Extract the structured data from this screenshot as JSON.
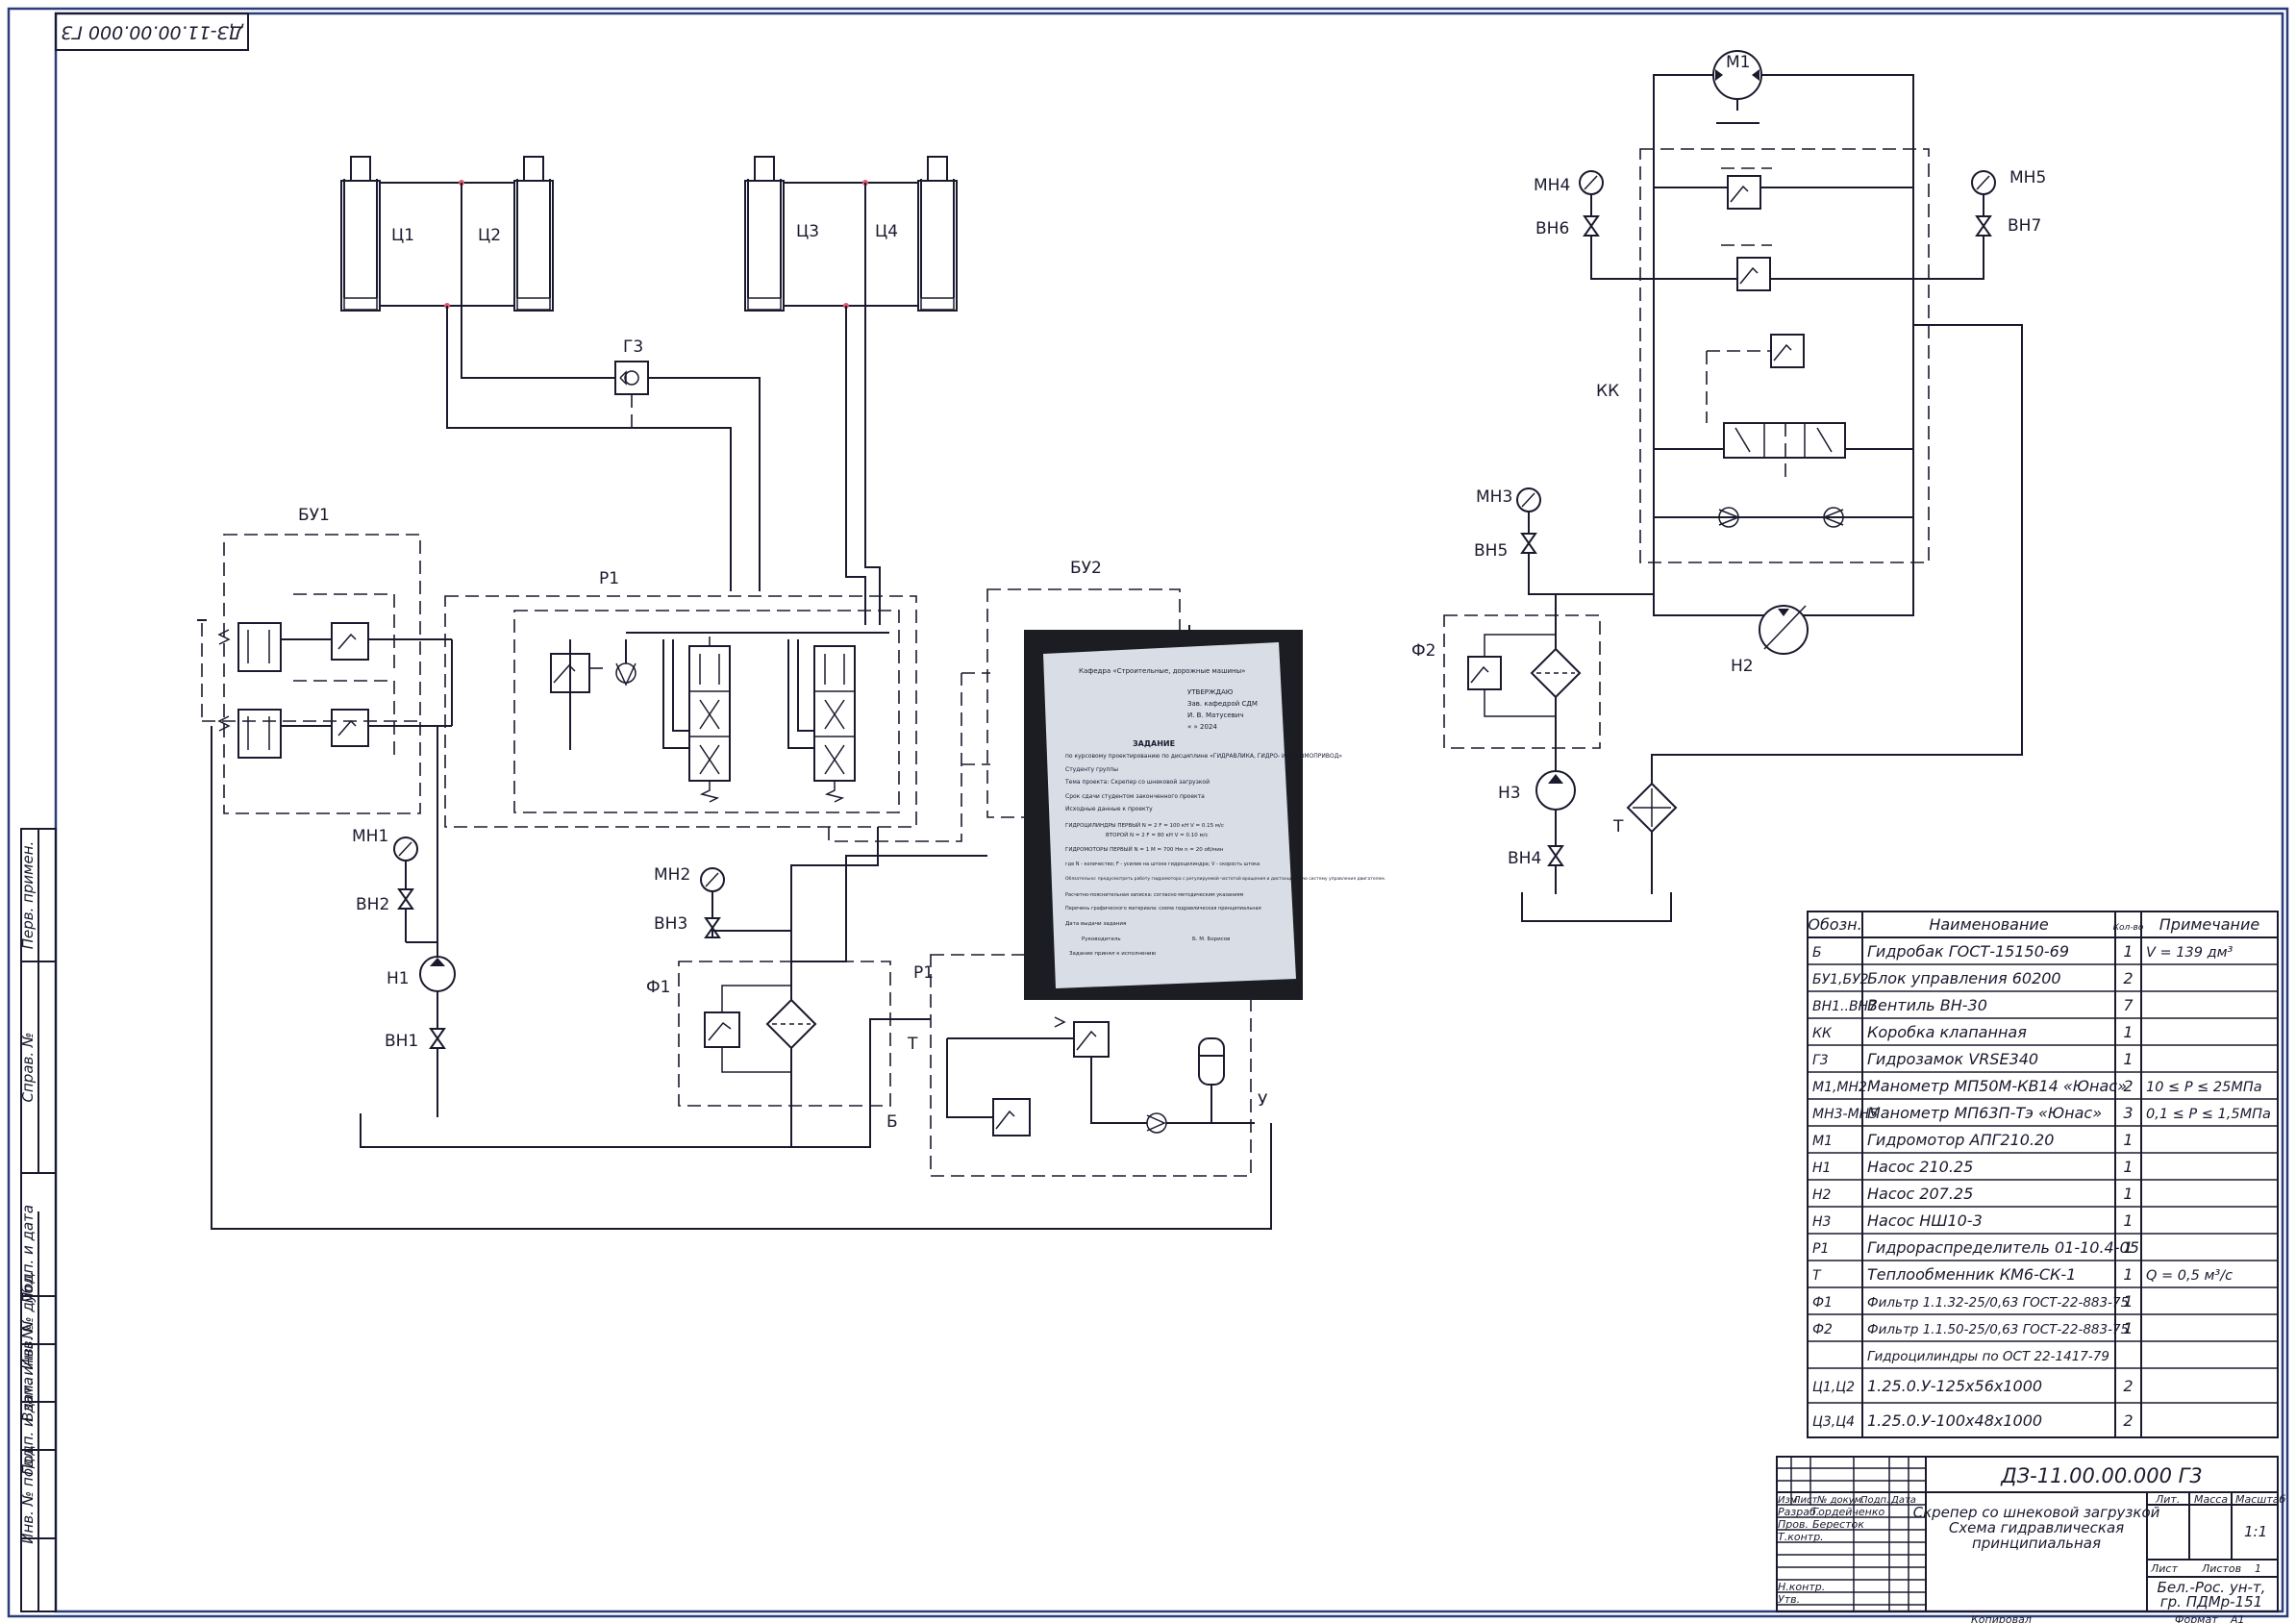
{
  "drawing": {
    "code": "ДЗ-11.00.00.000 Г3",
    "code_mirrored": "ДЗ-11.00.00.000 Г3"
  },
  "labels": {
    "c1": "Ц1",
    "c2": "Ц2",
    "c3": "Ц3",
    "c4": "Ц4",
    "g3": "Г3",
    "bu1": "БУ1",
    "bu2": "БУ2",
    "r1_top": "Р1",
    "r1_bottom": "Р1",
    "mn1": "МН1",
    "vn2": "ВН2",
    "n1": "Н1",
    "vn1": "ВН1",
    "mn2": "МН2",
    "vn3": "ВН3",
    "f1": "Ф1",
    "b": "Б",
    "t_left": "Т",
    "u": "У",
    "m1": "М1",
    "mn4": "МН4",
    "vn6": "ВН6",
    "mn5": "МН5",
    "vn7": "ВН7",
    "kk": "КК",
    "mn3": "МН3",
    "vn5": "ВН5",
    "f2": "Ф2",
    "n2": "Н2",
    "n3": "Н3",
    "vn4": "ВН4",
    "t_right": "Т"
  },
  "photo": {
    "org_line": "Кафедра «Строительные, дорожные машины»",
    "approve": "УТВЕРЖДАЮ",
    "head": "Зав. кафедрой СДМ",
    "head_name": "И. В. Матусевич",
    "date_placeholder": "« » 2024",
    "task_title": "ЗАДАНИЕ",
    "task_sub": "по курсовому проектированию по дисциплине «ГИДРАВЛИКА, ГИДРО- И ПНЕВМОПРИВОД»",
    "student_line": "Студенту группы",
    "project_line": "Тема проекта: Скрепер со шнековой загрузкой",
    "deadline_line": "Срок сдачи студентом законченного проекта",
    "data_line": "Исходные данные к проекту",
    "hydro1": "ГИДРОЦИЛИНДРЫ ПЕРВЫЙ  N = 2  F = 100 кН  V = 0.15 м/с",
    "hydro2": "ВТОРОЙ  N = 2  F = 80 кН  V = 0.10 м/с",
    "motor": "ГИДРОМОТОРЫ  ПЕРВЫЙ  N = 1  М = 700 Нм  n = 20 об/мин",
    "note1": "где N - количество; F - усилие на штоке гидроцилиндра; V - скорость штока",
    "note2": "Обязательно: предусмотреть работу гидромотора с регулируемой частотой вращения и дистанционную систему управления двигателем.",
    "contents": "Расчетно-пояснительная записка: согласно методическим указаниям",
    "graphics": "Перечень графического материала: схема гидравлическая принципиальная",
    "issued": "Дата выдачи задания",
    "leader": "Руководитель",
    "leader_name": "Б. М. Борисов",
    "accepted": "Задание принял к исполнению"
  },
  "spec": {
    "headers": [
      "Обозн.",
      "Наименование",
      "Кол-во",
      "Примечание"
    ],
    "rows": [
      [
        "Б",
        "Гидробак ГОСТ-15150-69",
        "1",
        "V = 139 дм³"
      ],
      [
        "БУ1,БУ2",
        "Блок управления 60200",
        "2",
        ""
      ],
      [
        "ВН1..ВН7",
        "Вентиль ВН-30",
        "7",
        ""
      ],
      [
        "КК",
        "Коробка клапанная",
        "1",
        ""
      ],
      [
        "Г3",
        "Гидрозамок VRSE340",
        "1",
        ""
      ],
      [
        "М1,МН2",
        "Манометр МП50М-КВ14 «Юнас»",
        "2",
        "10 ≤ P ≤ 25МПа"
      ],
      [
        "МН3-МН5",
        "Манометр МП63П-Тэ «Юнас»",
        "3",
        "0,1 ≤ P ≤ 1,5МПа"
      ],
      [
        "М1",
        "Гидромотор АПГ210.20",
        "1",
        ""
      ],
      [
        "Н1",
        "Насос 210.25",
        "1",
        ""
      ],
      [
        "Н2",
        "Насос 207.25",
        "1",
        ""
      ],
      [
        "Н3",
        "Насос НШ10-3",
        "1",
        ""
      ],
      [
        "Р1",
        "Гидрораспределитель 01-10.4-05",
        "1",
        ""
      ],
      [
        "Т",
        "Теплообменник КМ6-СК-1",
        "1",
        "Q = 0,5 м³/с"
      ],
      [
        "Ф1",
        "Фильтр 1.1.32-25/0,63 ГОСТ-22-883-75",
        "1",
        ""
      ],
      [
        "Ф2",
        "Фильтр 1.1.50-25/0,63 ГОСТ-22-883-75",
        "1",
        ""
      ],
      [
        "",
        "Гидроцилиндры по ОСТ 22-1417-79",
        "",
        ""
      ],
      [
        "Ц1,Ц2",
        "1.25.0.У-125х56х1000",
        "2",
        ""
      ],
      [
        "Ц3,Ц4",
        "1.25.0.У-100х48х1000",
        "2",
        ""
      ]
    ]
  },
  "title_block": {
    "code": "ДЗ-11.00.00.000 Г3",
    "name_line1": "Скрепер со шнековой загрузкой",
    "name_line2": "Схема гидравлическая",
    "name_line3": "принципиальная",
    "col_izm": "Изм",
    "col_list": "Лист",
    "col_doc": "№ докум.",
    "col_sign": "Подп.",
    "col_date": "Дата",
    "razrab": "Разраб.",
    "razrab_name": "Гордейченко",
    "prov": "Пров.",
    "prov_name": "Бересток",
    "tkontr": "Т.контр.",
    "nkontr": "Н.контр.",
    "utv": "Утв.",
    "lit": "Лит.",
    "massa": "Масса",
    "masshtab": "Масштаб",
    "scale_value": "1:1",
    "sheet": "Лист",
    "sheets": "Листов",
    "sheets_value": "1",
    "org_line1": "Бел.-Рос. ун-т,",
    "org_line2": "гр. ПДМр-151",
    "copied": "Копировал",
    "format": "Формат",
    "format_value": "А1"
  },
  "side_stamps": {
    "perv_primen": "Перв. примен.",
    "sprav": "Справ. №",
    "podp_data1": "Подп. и дата",
    "inv_dubl": "Инв. № дубл.",
    "vzam_inv": "Взам. инв. №",
    "podp_data2": "Подп. и дата",
    "inv_podl": "Инв. № подл."
  }
}
